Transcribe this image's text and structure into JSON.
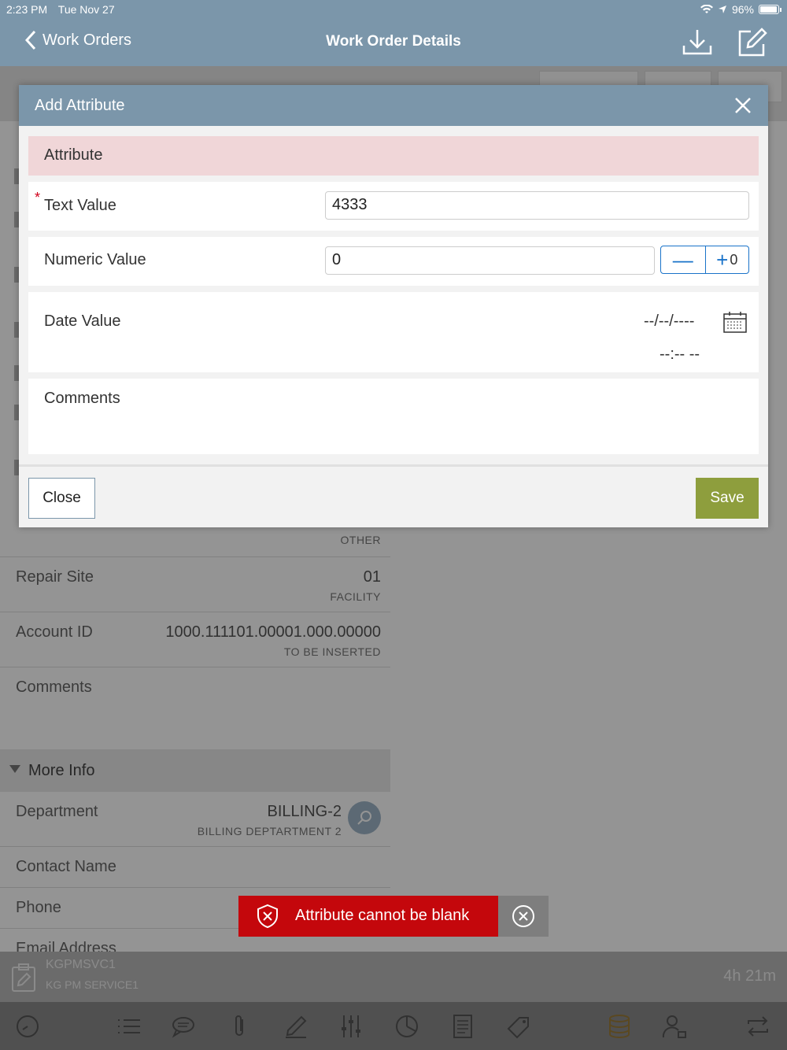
{
  "status_bar": {
    "time": "2:23 PM",
    "date": "Tue Nov 27",
    "battery": "96%"
  },
  "nav": {
    "back_label": "Work Orders",
    "title": "Work Order Details"
  },
  "background": {
    "rows": [
      {
        "label": "",
        "value": "",
        "sub": "OTHER"
      },
      {
        "label": "Repair Site",
        "value": "01",
        "sub": "FACILITY"
      },
      {
        "label": "Account ID",
        "value": "1000.111101.00001.000.00000",
        "sub": "TO BE INSERTED"
      },
      {
        "label": "Comments",
        "value": "",
        "sub": ""
      }
    ],
    "more_info": {
      "header": "More Info",
      "department": {
        "label": "Department",
        "value": "BILLING-2",
        "sub": "BILLING DEPTARTMENT 2"
      },
      "contact_name": {
        "label": "Contact Name"
      },
      "phone": {
        "label": "Phone"
      },
      "email": {
        "label": "Email Address"
      }
    },
    "footer": {
      "service_code": "KGPMSVC1",
      "service_name": "KG PM SERVICE1",
      "timer": "4h 21m"
    }
  },
  "modal": {
    "title": "Add Attribute",
    "attribute_label": "Attribute",
    "required_marker": "*",
    "text_value": {
      "label": "Text Value",
      "value": "4333"
    },
    "numeric_value": {
      "label": "Numeric Value",
      "value": "0",
      "stepper_minus": "—",
      "stepper_plus": "+",
      "stepper_extra": "0"
    },
    "date_value": {
      "label": "Date Value",
      "date_placeholder": "--/--/----",
      "time_placeholder": "--:-- --"
    },
    "comments": {
      "label": "Comments"
    },
    "close_label": "Close",
    "save_label": "Save"
  },
  "toast": {
    "message": "Attribute cannot be blank"
  },
  "colors": {
    "nav": "#7b96aa",
    "save": "#8e9e3d",
    "toast": "#c4070c",
    "attribute_bg": "#f0d6d8"
  }
}
